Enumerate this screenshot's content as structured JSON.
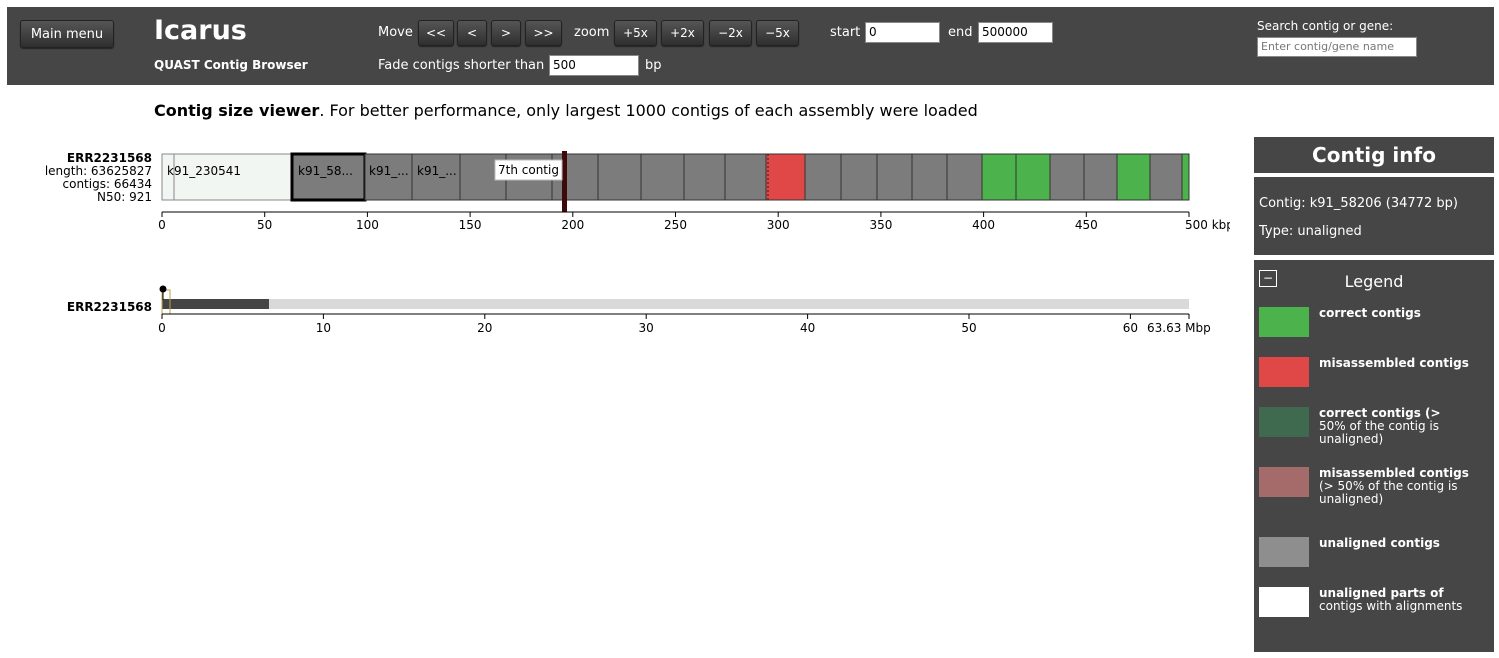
{
  "header": {
    "main_menu_label": "Main menu",
    "app_title": "Icarus",
    "app_subtitle": "QUAST Contig Browser",
    "move_label": "Move",
    "move_buttons": [
      "<<",
      "<",
      ">",
      ">>"
    ],
    "zoom_label": "zoom",
    "zoom_buttons": [
      "+5x",
      "+2x",
      "−2x",
      "−5x"
    ],
    "start_label": "start",
    "start_value": "0",
    "end_label": "end",
    "end_value": "500000",
    "fade_label": "Fade contigs shorter than",
    "fade_value": "500",
    "fade_unit": "bp",
    "search_label": "Search contig or gene:",
    "search_placeholder": "Enter contig/gene name"
  },
  "main": {
    "info_bold": "Contig size viewer",
    "info_rest": ". For better performance, only largest 1000 contigs of each assembly were loaded",
    "assembly": {
      "name": "ERR2231568",
      "length": "length: 63625827",
      "contigs": "contigs: 66434",
      "n50": "N50: 921"
    },
    "top_axis": {
      "ticks": [
        "0",
        "50",
        "100",
        "150",
        "200",
        "250",
        "300",
        "350",
        "400",
        "450",
        "500 kbp"
      ]
    },
    "contig_labels": [
      "k91_230541",
      "k91_58...",
      "k91_...",
      "k91_..."
    ],
    "marker_label": "7th contig",
    "overview": {
      "name": "ERR2231568",
      "ticks": [
        "0",
        "10",
        "20",
        "30",
        "40",
        "50",
        "60",
        "63.63 Mbp"
      ]
    }
  },
  "contig_info": {
    "title": "Contig info",
    "contig": "Contig: k91_58206 (34772 bp)",
    "type": "Type: unaligned"
  },
  "legend": {
    "title": "Legend",
    "collapse_symbol": "−",
    "items": [
      {
        "bold": "correct contigs",
        "rest": "",
        "color": "#4cb34c"
      },
      {
        "bold": "misassembled contigs",
        "rest": "",
        "color": "#e04848"
      },
      {
        "bold": "correct contigs (>",
        "rest": "50% of the contig is unaligned)",
        "color": "#3f6a4f"
      },
      {
        "bold": "misassembled contigs",
        "rest": "(> 50% of the contig is unaligned)",
        "color": "#a56b6b"
      },
      {
        "bold": "unaligned contigs",
        "rest": "",
        "color": "#8e8e8e"
      },
      {
        "bold": "unaligned parts of",
        "rest": "contigs with alignments",
        "color": "#ffffff"
      }
    ]
  },
  "colors": {
    "header_bg": "#464646",
    "correct": "#4cb34c",
    "misassembled": "#e04848",
    "unaligned": "#7c7c7c",
    "unaligned_part": "#f1f6f3",
    "overview_fill": "#444444",
    "overview_bg": "#d9d9d9"
  }
}
